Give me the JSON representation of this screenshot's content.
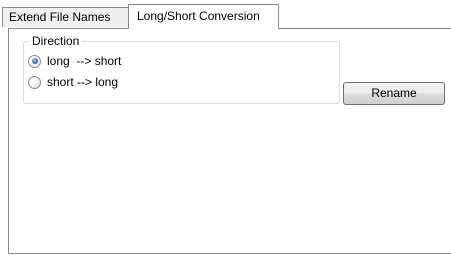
{
  "tabs": [
    {
      "label": "Extend File Names",
      "active": false
    },
    {
      "label": "Long/Short Conversion",
      "active": true
    }
  ],
  "direction_group": {
    "legend": "Direction",
    "options": [
      {
        "label": "long  --> short",
        "checked": true
      },
      {
        "label": "short --> long",
        "checked": false
      }
    ]
  },
  "rename_button": {
    "label": "Rename"
  }
}
